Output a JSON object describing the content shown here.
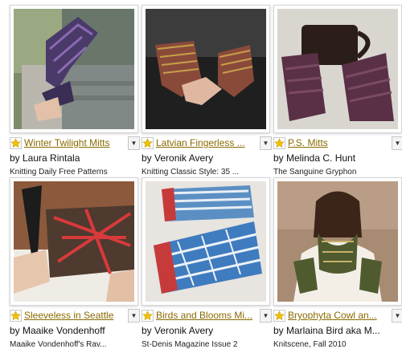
{
  "colors": {
    "title_link": "#8a6a00",
    "star": "#f2c200"
  },
  "patterns": [
    {
      "title": "Winter Twilight Mitts",
      "designer": "by Laura Rintala",
      "source": "Knitting Daily Free Patterns"
    },
    {
      "title": "Latvian Fingerless ...",
      "designer": "by Veronik Avery",
      "source": "Knitting Classic Style: 35 ..."
    },
    {
      "title": "P.S. Mitts",
      "designer": "by Melinda C. Hunt",
      "source": "The Sanguine Gryphon"
    },
    {
      "title": "Sleeveless in Seattle",
      "designer": "by Maaike Vondenhoff",
      "source": "Maaike Vondenhoff's Rav..."
    },
    {
      "title": "Birds and Blooms Mi...",
      "designer": "by Veronik Avery",
      "source": "St-Denis Magazine Issue 2"
    },
    {
      "title": "Bryophyta Cowl an...",
      "designer": "by Marlaina Bird aka M...",
      "source": "Knitscene, Fall 2010"
    }
  ]
}
